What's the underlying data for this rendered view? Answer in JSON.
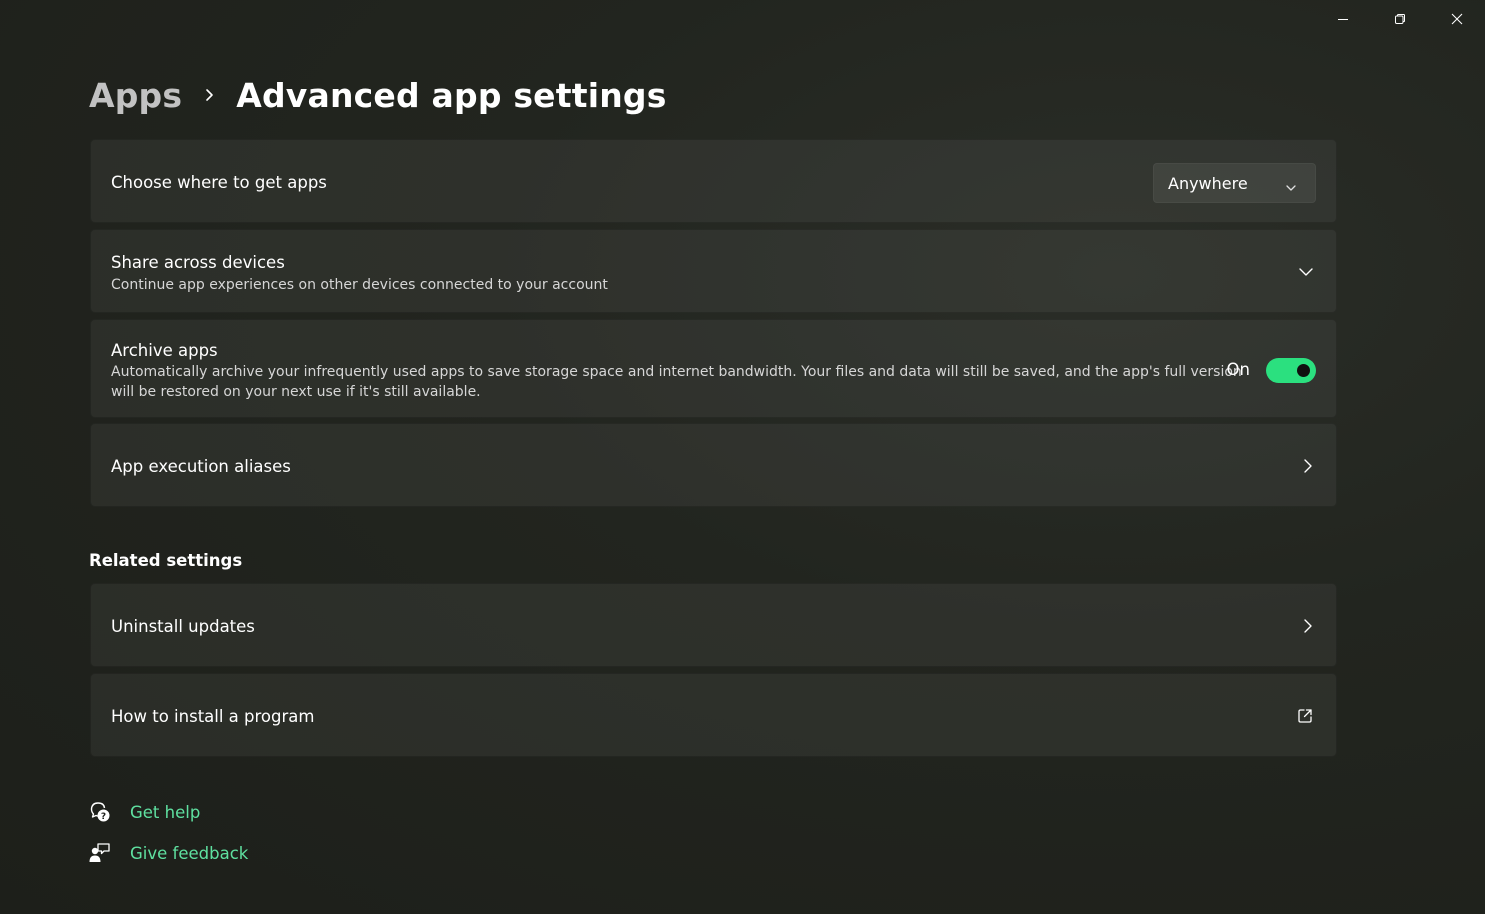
{
  "window": {
    "minimize_icon": "minimize-icon",
    "restore_icon": "restore-icon",
    "close_icon": "close-icon"
  },
  "breadcrumb": {
    "parent": "Apps",
    "current": "Advanced app settings"
  },
  "cards": {
    "choose_source": {
      "title": "Choose where to get apps",
      "dropdown_value": "Anywhere"
    },
    "share_devices": {
      "title": "Share across devices",
      "description": "Continue app experiences on other devices connected to your account"
    },
    "archive_apps": {
      "title": "Archive apps",
      "description_line1": "Automatically archive your infrequently used apps to save storage space and internet bandwidth. Your files and data will still be saved, and the app's full version",
      "description_line2": "will be restored on your next use if it's still available.",
      "toggle_label": "On",
      "toggle_on": true
    },
    "execution_aliases": {
      "title": "App execution aliases"
    }
  },
  "related": {
    "heading": "Related settings",
    "uninstall_updates": "Uninstall updates",
    "how_to_install": "How to install a program"
  },
  "footer": {
    "get_help": "Get help",
    "give_feedback": "Give feedback"
  },
  "colors": {
    "accent": "#5fe0a0",
    "toggle_on": "#2be07f"
  }
}
